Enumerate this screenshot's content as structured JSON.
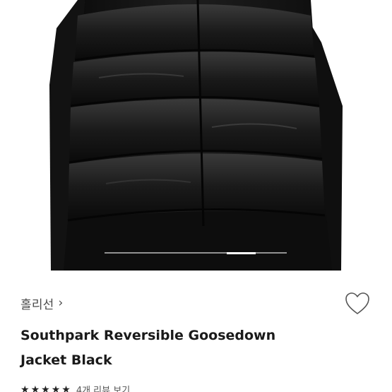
{
  "product": {
    "brand": "홀리선",
    "brand_chevron": "›",
    "title": "Southpark Reversible Goosedown Jacket Black",
    "review_text": "4개 리뷰 보기",
    "rating_stars": 5,
    "star_glyph": "★"
  },
  "gallery": {
    "image_icon": "puffer-jacket-photo",
    "active_slide_fraction_start": 0.67,
    "active_slide_fraction_end": 0.83
  },
  "colors": {
    "text_primary": "#1a1a1a",
    "text_secondary": "#4a4a4a",
    "jacket": "#141414"
  }
}
